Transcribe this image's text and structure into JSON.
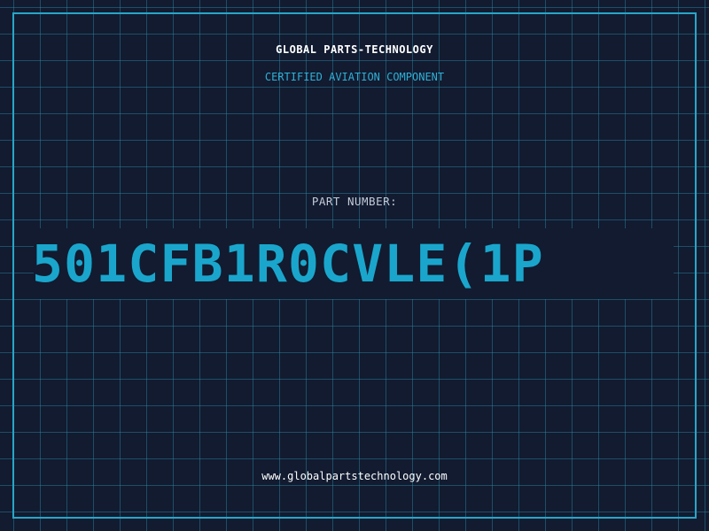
{
  "header": {
    "brand": "GLOBAL PARTS-TECHNOLOGY",
    "subtitle": "CERTIFIED AVIATION COMPONENT"
  },
  "part": {
    "label": "PART NUMBER:",
    "number": "501CFB1R0CVLE(1P"
  },
  "footer": {
    "url": "www.globalpartstechnology.com"
  },
  "colors": {
    "background": "#121b30",
    "grid": "#2d8caa",
    "accent": "#26a6c9",
    "part_number": "#1aa6cc",
    "text": "#ffffff"
  }
}
